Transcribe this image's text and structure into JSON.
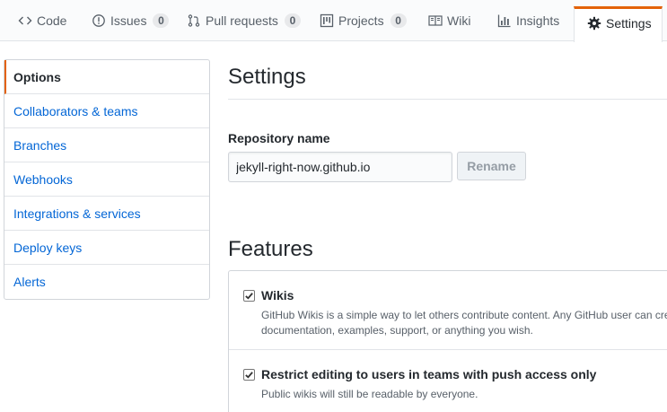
{
  "tabs": [
    {
      "label": "Code",
      "icon": "code-icon"
    },
    {
      "label": "Issues",
      "icon": "issue-icon",
      "count": "0"
    },
    {
      "label": "Pull requests",
      "icon": "pull-request-icon",
      "count": "0"
    },
    {
      "label": "Projects",
      "icon": "project-icon",
      "count": "0"
    },
    {
      "label": "Wiki",
      "icon": "book-icon"
    },
    {
      "label": "Insights",
      "icon": "graph-icon"
    },
    {
      "label": "Settings",
      "icon": "gear-icon",
      "selected": true
    }
  ],
  "menu": {
    "items": [
      {
        "label": "Options",
        "selected": true
      },
      {
        "label": "Collaborators & teams"
      },
      {
        "label": "Branches"
      },
      {
        "label": "Webhooks"
      },
      {
        "label": "Integrations & services"
      },
      {
        "label": "Deploy keys"
      },
      {
        "label": "Alerts"
      }
    ]
  },
  "main": {
    "title": "Settings",
    "repo_name_label": "Repository name",
    "repo_name_value": "jekyll-right-now.github.io",
    "rename_label": "Rename",
    "features_title": "Features",
    "features": [
      {
        "title": "Wikis",
        "checked": true,
        "desc_line1": "GitHub Wikis is a simple way to let others contribute content. Any GitHub user can cre",
        "desc_line2": "documentation, examples, support, or anything you wish."
      },
      {
        "title": "Restrict editing to users in teams with push access only",
        "checked": true,
        "desc_line1": "Public wikis will still be readable by everyone."
      }
    ]
  },
  "colors": {
    "accent": "#e36209",
    "link": "#0366d6",
    "text": "#24292e",
    "muted": "#586069"
  }
}
